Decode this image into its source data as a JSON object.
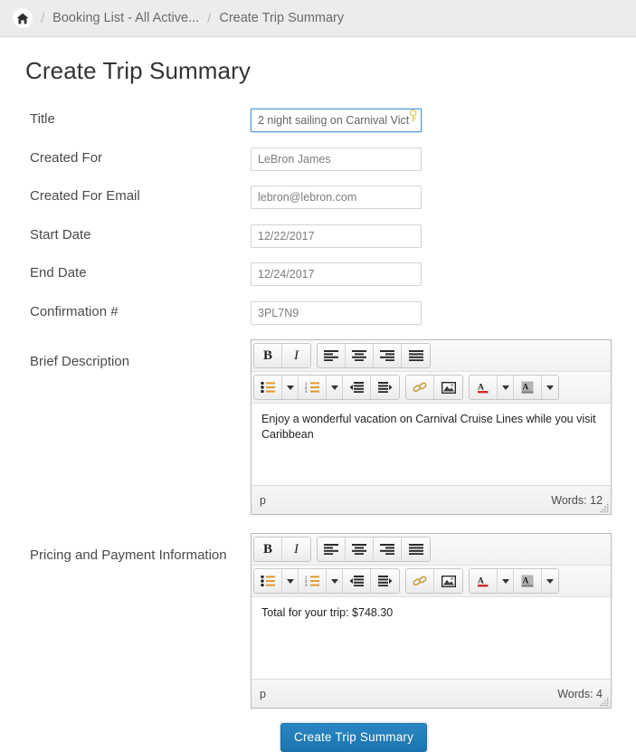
{
  "breadcrumb": {
    "home_icon": "home-icon",
    "separator": "/",
    "items": [
      {
        "label": "Booking List - All Active...",
        "link": true
      },
      {
        "label": "Create Trip Summary",
        "link": false
      }
    ]
  },
  "page": {
    "title": "Create Trip Summary"
  },
  "form": {
    "fields": [
      {
        "label": "Title",
        "value": "2 night sailing on Carnival Vict",
        "focused": true,
        "badge": "key-icon"
      },
      {
        "label": "Created For",
        "value": "LeBron James",
        "focused": false
      },
      {
        "label": "Created For Email",
        "value": "lebron@lebron.com",
        "focused": false
      },
      {
        "label": "Start Date",
        "value": "12/22/2017",
        "focused": false
      },
      {
        "label": "End Date",
        "value": "12/24/2017",
        "focused": false
      },
      {
        "label": "Confirmation #",
        "value": "3PL7N9",
        "focused": false
      }
    ]
  },
  "toolbar": {
    "buttons_row1": [
      {
        "name": "bold",
        "glyph": "B"
      },
      {
        "name": "italic",
        "glyph": "I"
      },
      {
        "name": "align-left"
      },
      {
        "name": "align-center"
      },
      {
        "name": "align-right"
      },
      {
        "name": "align-justify"
      }
    ],
    "buttons_row2": [
      {
        "name": "bullet-list"
      },
      {
        "name": "numbered-list"
      },
      {
        "name": "outdent"
      },
      {
        "name": "indent"
      },
      {
        "name": "link"
      },
      {
        "name": "image"
      },
      {
        "name": "font-color",
        "glyph": "A"
      },
      {
        "name": "highlight-color",
        "glyph": "A"
      }
    ]
  },
  "editors": [
    {
      "label": "Brief Description",
      "content": "Enjoy a wonderful vacation on Carnival Cruise Lines while you visit Caribbean",
      "path": "p",
      "word_count_label": "Words: 12"
    },
    {
      "label": "Pricing and Payment Information",
      "content": "Total for your trip: $748.30",
      "path": "p",
      "word_count_label": "Words: 4"
    }
  ],
  "submit": {
    "label": "Create Trip Summary"
  },
  "colors": {
    "header_bg": "#ececec",
    "primary_button": "#217dbb",
    "focus_border": "#5b9dd9",
    "label_text": "#4a4a4a",
    "field_text": "#7d7d7d"
  }
}
